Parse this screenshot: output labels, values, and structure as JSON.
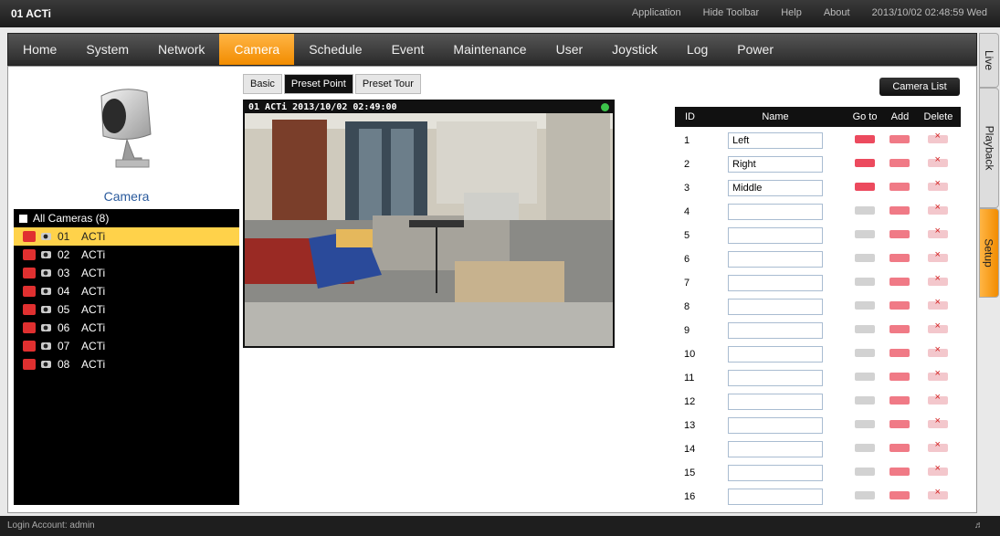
{
  "app": {
    "title": "01 ACTi",
    "datetime": "2013/10/02 02:48:59 Wed"
  },
  "toolbar": {
    "links": [
      "Application",
      "Hide Toolbar",
      "Help",
      "About"
    ]
  },
  "menu": {
    "items": [
      "Home",
      "System",
      "Network",
      "Camera",
      "Schedule",
      "Event",
      "Maintenance",
      "User",
      "Joystick",
      "Log",
      "Power"
    ],
    "active": "Camera"
  },
  "side_tabs": {
    "live": "Live",
    "playback": "Playback",
    "setup": "Setup",
    "active": "Setup"
  },
  "left": {
    "camera_label": "Camera",
    "tree_root": "All Cameras (8)",
    "cameras": [
      {
        "num": "01",
        "name": "ACTi"
      },
      {
        "num": "02",
        "name": "ACTi"
      },
      {
        "num": "03",
        "name": "ACTi"
      },
      {
        "num": "04",
        "name": "ACTi"
      },
      {
        "num": "05",
        "name": "ACTi"
      },
      {
        "num": "06",
        "name": "ACTi"
      },
      {
        "num": "07",
        "name": "ACTi"
      },
      {
        "num": "08",
        "name": "ACTi"
      }
    ],
    "selected_index": 0
  },
  "tabs": {
    "basic": "Basic",
    "preset_point": "Preset Point",
    "preset_tour": "Preset Tour",
    "active": "Preset Point"
  },
  "camera_list_button": "Camera List",
  "video": {
    "osd": "01 ACTi   2013/10/02 02:49:00"
  },
  "preset_table": {
    "headers": {
      "id": "ID",
      "name": "Name",
      "goto": "Go to",
      "add": "Add",
      "delete": "Delete"
    },
    "rows": [
      {
        "id": "1",
        "name": "Left"
      },
      {
        "id": "2",
        "name": "Right"
      },
      {
        "id": "3",
        "name": "Middle"
      },
      {
        "id": "4",
        "name": ""
      },
      {
        "id": "5",
        "name": ""
      },
      {
        "id": "6",
        "name": ""
      },
      {
        "id": "7",
        "name": ""
      },
      {
        "id": "8",
        "name": ""
      },
      {
        "id": "9",
        "name": ""
      },
      {
        "id": "10",
        "name": ""
      },
      {
        "id": "11",
        "name": ""
      },
      {
        "id": "12",
        "name": ""
      },
      {
        "id": "13",
        "name": ""
      },
      {
        "id": "14",
        "name": ""
      },
      {
        "id": "15",
        "name": ""
      },
      {
        "id": "16",
        "name": ""
      }
    ]
  },
  "status": {
    "login": "Login Account: admin"
  },
  "colors": {
    "accent": "#f28c00",
    "selected_row": "#ffd24a",
    "rec": "#e03030"
  }
}
